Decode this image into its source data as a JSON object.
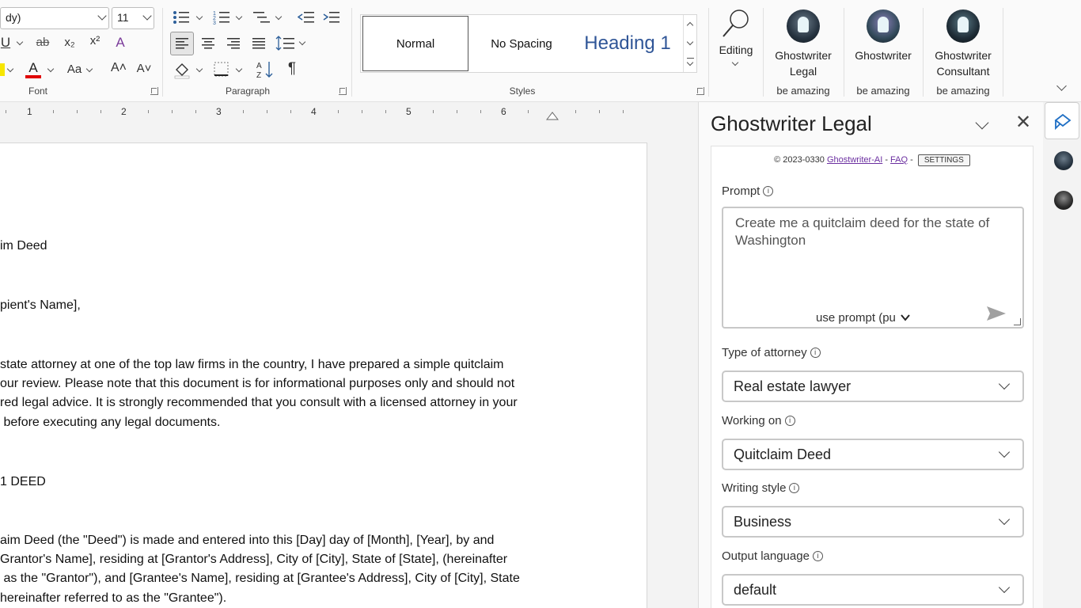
{
  "ribbon": {
    "font": {
      "name_value": "dy)",
      "size_value": "11",
      "group_label": "Font",
      "underline_glyph": "U",
      "strike_glyph": "ab",
      "subscript_glyph": "x₂",
      "superscript_glyph": "x²",
      "font_color_glyph": "A",
      "change_case_glyph": "Aa",
      "grow_glyph": "A˄",
      "shrink_glyph": "A˅",
      "clear_format_glyph": "A"
    },
    "paragraph": {
      "group_label": "Paragraph"
    },
    "styles": {
      "group_label": "Styles",
      "items": [
        "Normal",
        "No Spacing",
        "Heading 1"
      ]
    },
    "editing": {
      "label": "Editing"
    },
    "addins": [
      {
        "name_line1": "Ghostwriter",
        "name_line2": "Legal",
        "subtitle": "be amazing"
      },
      {
        "name_line1": "Ghostwriter",
        "name_line2": "",
        "subtitle": "be amazing"
      },
      {
        "name_line1": "Ghostwriter",
        "name_line2": "Consultant",
        "subtitle": "be amazing"
      }
    ]
  },
  "ruler": {
    "numbers": [
      "1",
      "2",
      "3",
      "4",
      "5",
      "6"
    ]
  },
  "document": {
    "lines": [
      "im Deed",
      "pient's Name],",
      "state attorney at one of the top law firms in the country, I have prepared a simple quitclaim",
      "our review. Please note that this document is for informational purposes only and should not",
      "red legal advice. It is strongly recommended that you consult with a licensed attorney in your",
      " before executing any legal documents.",
      "1 DEED",
      "aim Deed (the \"Deed\") is made and entered into this [Day] day of [Month], [Year], by and",
      "Grantor's Name], residing at [Grantor's Address], City of [City], State of [State], (hereinafter",
      " as the \"Grantor\"), and [Grantee's Name], residing at [Grantee's Address], City of [City], State",
      "hereinafter referred to as the \"Grantee\")."
    ]
  },
  "pane": {
    "title": "Ghostwriter Legal",
    "close_glyph": "✕",
    "copyright_prefix": "© 2023-0330",
    "copyright_link": "Ghostwriter-AI",
    "faq_link": "FAQ",
    "settings_label": "SETTINGS",
    "prompt": {
      "label": "Prompt",
      "value": "Create me a quitclaim deed for the state of Washington",
      "mode": "use prompt (pu"
    },
    "fields": [
      {
        "label": "Type of attorney",
        "value": "Real estate lawyer"
      },
      {
        "label": "Working on",
        "value": "Quitclaim Deed"
      },
      {
        "label": "Writing style",
        "value": "Business"
      },
      {
        "label": "Output language",
        "value": "default"
      }
    ],
    "info_glyph": "i"
  },
  "colors": {
    "accent_heading": "#2f5597",
    "link_purple": "#6b2fa0",
    "font_color_red": "#e00000"
  }
}
